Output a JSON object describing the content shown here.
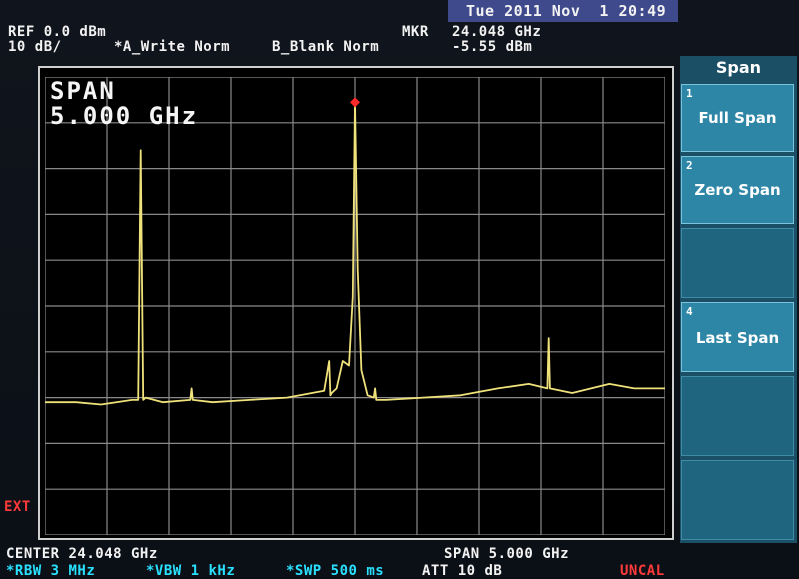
{
  "header": {
    "datetime": "Tue 2011 Nov  1 20:49",
    "ref_level": "REF 0.0 dBm",
    "scale": "10 dB/",
    "trace_a": "*A_Write Norm",
    "trace_b": "B_Blank Norm",
    "marker_label": "MKR",
    "marker_freq": "24.048 GHz",
    "marker_level": "-5.55 dBm"
  },
  "display": {
    "span_title": "SPAN",
    "span_value": "5.000 GHz",
    "ext_indicator": "EXT"
  },
  "footer": {
    "center": "CENTER 24.048 GHz",
    "span": "SPAN 5.000 GHz",
    "rbw": "*RBW 3 MHz",
    "vbw": "*VBW 1 kHz",
    "swp": "*SWP 500 ms",
    "att": "ATT 10 dB",
    "uncal": "UNCAL"
  },
  "softkeys": {
    "menu_title": "Span",
    "items": [
      {
        "num": "1",
        "label": "Full Span"
      },
      {
        "num": "2",
        "label": "Zero Span"
      },
      {
        "num": "4",
        "label": "Last Span"
      }
    ]
  },
  "chart_data": {
    "type": "line",
    "xlabel": "",
    "ylabel": "",
    "x_center_ghz": 24.048,
    "x_span_ghz": 5.0,
    "xlim": [
      21.548,
      26.548
    ],
    "ylim": [
      -100,
      0
    ],
    "grid": true,
    "series": [
      {
        "x": [
          21.548,
          21.8,
          22.0,
          22.25,
          22.3,
          22.32,
          22.34,
          22.36,
          22.5,
          22.72,
          22.73,
          22.74,
          22.9,
          23.2,
          23.5,
          23.8,
          23.84,
          23.85,
          23.86,
          23.9,
          23.95,
          24.0,
          24.03,
          24.048,
          24.07,
          24.1,
          24.15,
          24.2,
          24.21,
          24.22,
          24.3,
          24.6,
          24.9,
          25.2,
          25.45,
          25.6,
          25.61,
          25.62,
          25.8,
          26.1,
          26.3,
          26.548
        ],
        "y": [
          -71,
          -71,
          -71.5,
          -70.5,
          -70.5,
          -16,
          -70.5,
          -70,
          -71,
          -70.5,
          -68,
          -70.5,
          -71,
          -70.5,
          -70,
          -68.5,
          -62,
          -69.5,
          -69,
          -68,
          -62,
          -63,
          -48,
          -5.55,
          -42,
          -64,
          -69.5,
          -70,
          -68,
          -70.5,
          -70.5,
          -70,
          -69.5,
          -68,
          -67,
          -68,
          -57,
          -68,
          -69,
          -67,
          -68,
          -68
        ]
      }
    ],
    "marker": {
      "x": 24.048,
      "y": -5.55
    }
  }
}
